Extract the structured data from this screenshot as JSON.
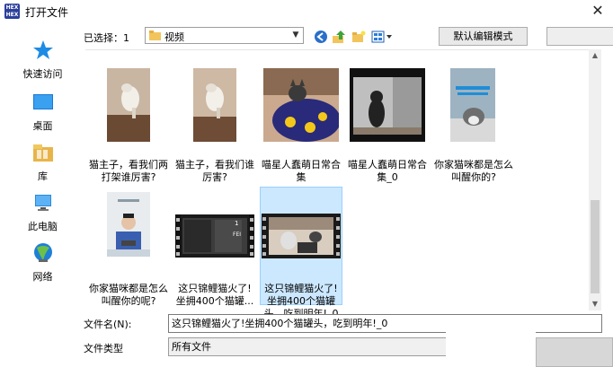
{
  "window": {
    "title": "打开文件",
    "app_logo_text": [
      "HEX",
      "HEX"
    ]
  },
  "places": [
    {
      "label": "快速访问",
      "icon": "star-icon"
    },
    {
      "label": "桌面",
      "icon": "desktop-icon"
    },
    {
      "label": "库",
      "icon": "library-icon"
    },
    {
      "label": "此电脑",
      "icon": "computer-icon"
    },
    {
      "label": "网络",
      "icon": "network-icon"
    }
  ],
  "toolbar": {
    "lookin_label": "已选择：1",
    "lookin_value": "视频",
    "mode_button": "默认编辑模式"
  },
  "files": [
    {
      "name": "猫主子，看我们两打架谁厉害?",
      "thumb": "cat-fight-1"
    },
    {
      "name": "猫主子，看我们谁厉害?",
      "thumb": "cat-fight-2"
    },
    {
      "name": "喵星人蠢萌日常合集",
      "thumb": "cat-blanket"
    },
    {
      "name": "喵星人蠢萌日常合集_0",
      "thumb": "cat-standing"
    },
    {
      "name": "你家猫咪都是怎么叫醒你的?",
      "thumb": "cat-bed"
    },
    {
      "name": "你家猫咪都是怎么叫醒你的呢?",
      "thumb": "man-cat"
    },
    {
      "name": "这只锦鲤猫火了!坐拥400个猫罐...",
      "thumb": "video-film"
    },
    {
      "name": "这只锦鲤猫火了!坐拥400个猫罐头，吃到明年!_0",
      "thumb": "video-film-selected",
      "selected": true
    }
  ],
  "video_badge": "FEI",
  "bottom": {
    "filename_label": "文件名(N):",
    "filename_value": "这只锦鲤猫火了!坐拥400个猫罐头，吃到明年!_0",
    "filetype_label": "文件类型",
    "filetype_value": "所有文件"
  },
  "colors": {
    "selection_bg": "#cce8ff",
    "selection_border": "#99d1ff",
    "places_blue": "#2a8ad8"
  }
}
